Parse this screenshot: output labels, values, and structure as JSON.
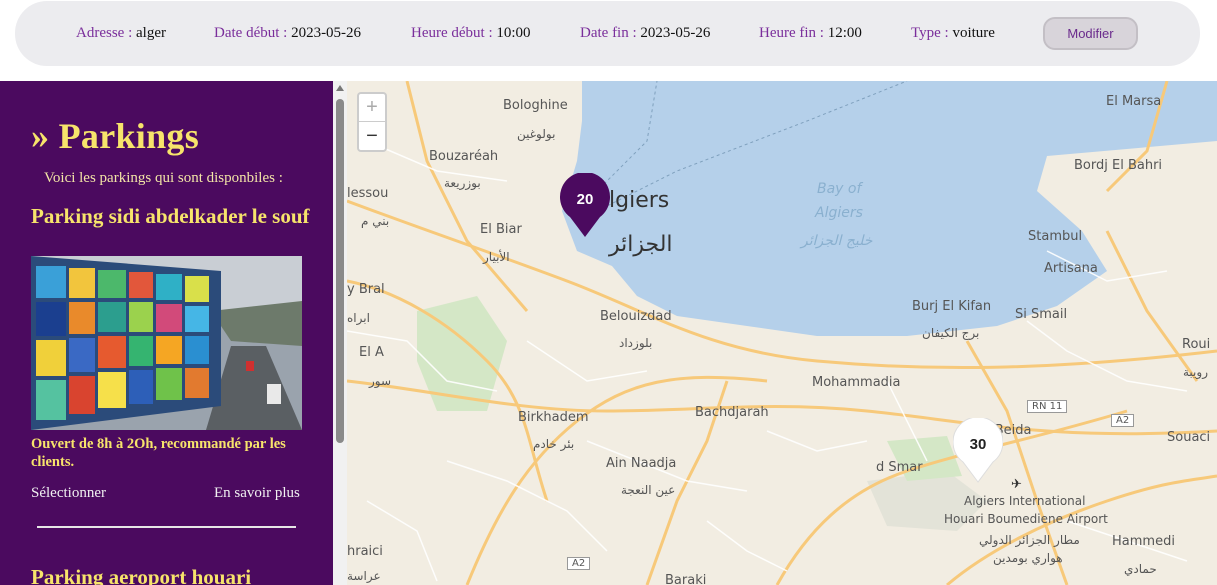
{
  "search": {
    "address_label": "Adresse :",
    "address_value": "alger",
    "start_date_label": "Date début :",
    "start_date_value": "2023-05-26",
    "start_time_label": "Heure début :",
    "start_time_value": "10:00",
    "end_date_label": "Date fin :",
    "end_date_value": "2023-05-26",
    "end_time_label": "Heure fin :",
    "end_time_value": "12:00",
    "type_label": "Type :",
    "type_value": "voiture",
    "modify_button": "Modifier"
  },
  "sidebar": {
    "title": "» Parkings",
    "subtitle": "Voici les parkings qui sont disponbiles :",
    "parkings": [
      {
        "name": "Parking sidi abdelkader le souf",
        "description": "Ouvert de 8h à 2Oh, recommandé par les clients.",
        "select_label": "Sélectionner",
        "more_label": "En savoir plus"
      },
      {
        "name": "Parking aeroport houari"
      }
    ]
  },
  "map": {
    "zoom_in": "+",
    "zoom_out": "−",
    "labels": {
      "bologhine": "Bologhine",
      "bologhine_ar": "بولوغين",
      "bouzareah": "Bouzaréah",
      "bouzareah_ar": "بوزريعة",
      "algiers": "lgiers",
      "algiers_ar": "الجزائر",
      "bay": "Bay of",
      "bay2": "Algiers",
      "bay_ar": "خليج الجزائر",
      "elbiar": "El Biar",
      "elbiar_ar": "الأبيار",
      "belouizdad": "Belouizdad",
      "belouizdad_ar": "بلوزداد",
      "mohammadia": "Mohammadia",
      "birkhadem": "Birkhadem",
      "birkhadem_ar": "بئر خادم",
      "bachdjarah": "Bachdjarah",
      "ainnaadja": "Ain Naadja",
      "ainnaadja_ar": "عين النعجة",
      "burjelkifan": "Burj El Kifan",
      "burjelkifan_ar": "برج الكيفان",
      "elmarsa": "El Marsa",
      "bordjelbahri": "Bordj El Bahri",
      "stambul": "Stambul",
      "artisana": "Artisana",
      "sismail": "Si Smail",
      "roui": "Roui",
      "rouiba_ar": "رويبة",
      "elbeida": "l Beida",
      "souaci": "Souaci",
      "darelbeida": "d Smar",
      "airport": "Algiers International",
      "airport2": "Houari Boumediene Airport",
      "airport_ar": "مطار الجزائر الدولي",
      "airport_ar2": "هواري بومدين",
      "hammedi": "Hammedi",
      "hammedi_ar": "حمادي",
      "rn11": "RN 11",
      "a2": "A2",
      "a2b": "A2",
      "baraki": "Baraki",
      "bral": "y Bral",
      "ela": "El A",
      "lessou": "lessou",
      "chraici": "hraici",
      "ar1": "بني م",
      "ar2": "ابراه",
      "ar3": "سور",
      "ar4": "عراسة"
    },
    "markers": [
      {
        "count": "20",
        "color": "#4b0a5f",
        "text_color": "#ffffff"
      },
      {
        "count": "30",
        "color": "#ffffff",
        "text_color": "#222222"
      }
    ],
    "colors": {
      "sea": "#b5d0ea",
      "land": "#f2ede2",
      "road_major": "#f7c97a",
      "road_minor": "#ffffff",
      "park": "#d4e7c6"
    }
  }
}
